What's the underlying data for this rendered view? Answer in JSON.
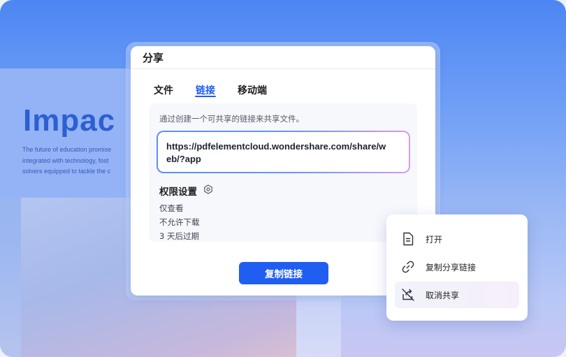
{
  "background": {
    "title": "Impac",
    "paragraph_lines": [
      "The future of education promise",
      "integrated with technology, fost",
      "solvers equipped to tackle the c"
    ]
  },
  "dialog": {
    "title": "分享",
    "tabs": [
      {
        "label": "文件",
        "active": false
      },
      {
        "label": "链接",
        "active": true
      },
      {
        "label": "移动端",
        "active": false
      }
    ],
    "description": "通过创建一个可共享的链接来共享文件。",
    "link_value": "https://pdfelementcloud.wondershare.com/share/web/?app",
    "permissions": {
      "title": "权限设置",
      "icon": "settings-hexagon-icon",
      "items": [
        "仅查看",
        "不允许下载",
        "3 天后过期"
      ]
    },
    "copy_button_label": "复制链接",
    "accent_color": "#1f5ef0"
  },
  "context_menu": {
    "items": [
      {
        "label": "打开",
        "icon": "document-icon",
        "highlighted": false
      },
      {
        "label": "复制分享链接",
        "icon": "link-icon",
        "highlighted": false
      },
      {
        "label": "取消共享",
        "icon": "unshare-icon",
        "highlighted": true
      }
    ]
  }
}
